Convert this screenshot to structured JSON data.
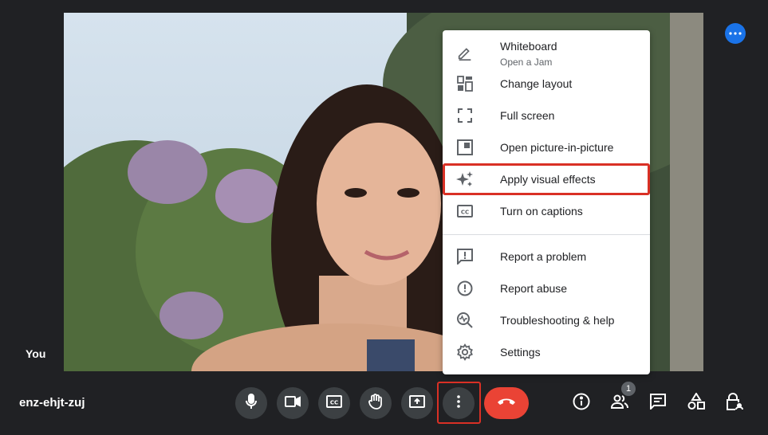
{
  "participant": {
    "self_label": "You"
  },
  "meeting": {
    "code": "enz-ehjt-zuj"
  },
  "menu": {
    "items": [
      {
        "label": "Whiteboard",
        "sublabel": "Open a Jam",
        "icon": "pencil-icon"
      },
      {
        "label": "Change layout",
        "icon": "layout-icon"
      },
      {
        "label": "Full screen",
        "icon": "fullscreen-icon"
      },
      {
        "label": "Open picture-in-picture",
        "icon": "pip-icon"
      },
      {
        "label": "Apply visual effects",
        "icon": "sparkle-icon",
        "highlighted": true
      },
      {
        "label": "Turn on captions",
        "icon": "captions-icon"
      },
      {
        "label": "Report a problem",
        "icon": "feedback-icon"
      },
      {
        "label": "Report abuse",
        "icon": "alert-icon"
      },
      {
        "label": "Troubleshooting & help",
        "icon": "troubleshoot-icon"
      },
      {
        "label": "Settings",
        "icon": "gear-icon"
      }
    ]
  },
  "controls": {
    "people_count": "1",
    "colors": {
      "end_call": "#ea4335",
      "accent": "#1a73e8",
      "highlight": "#d93025"
    }
  }
}
